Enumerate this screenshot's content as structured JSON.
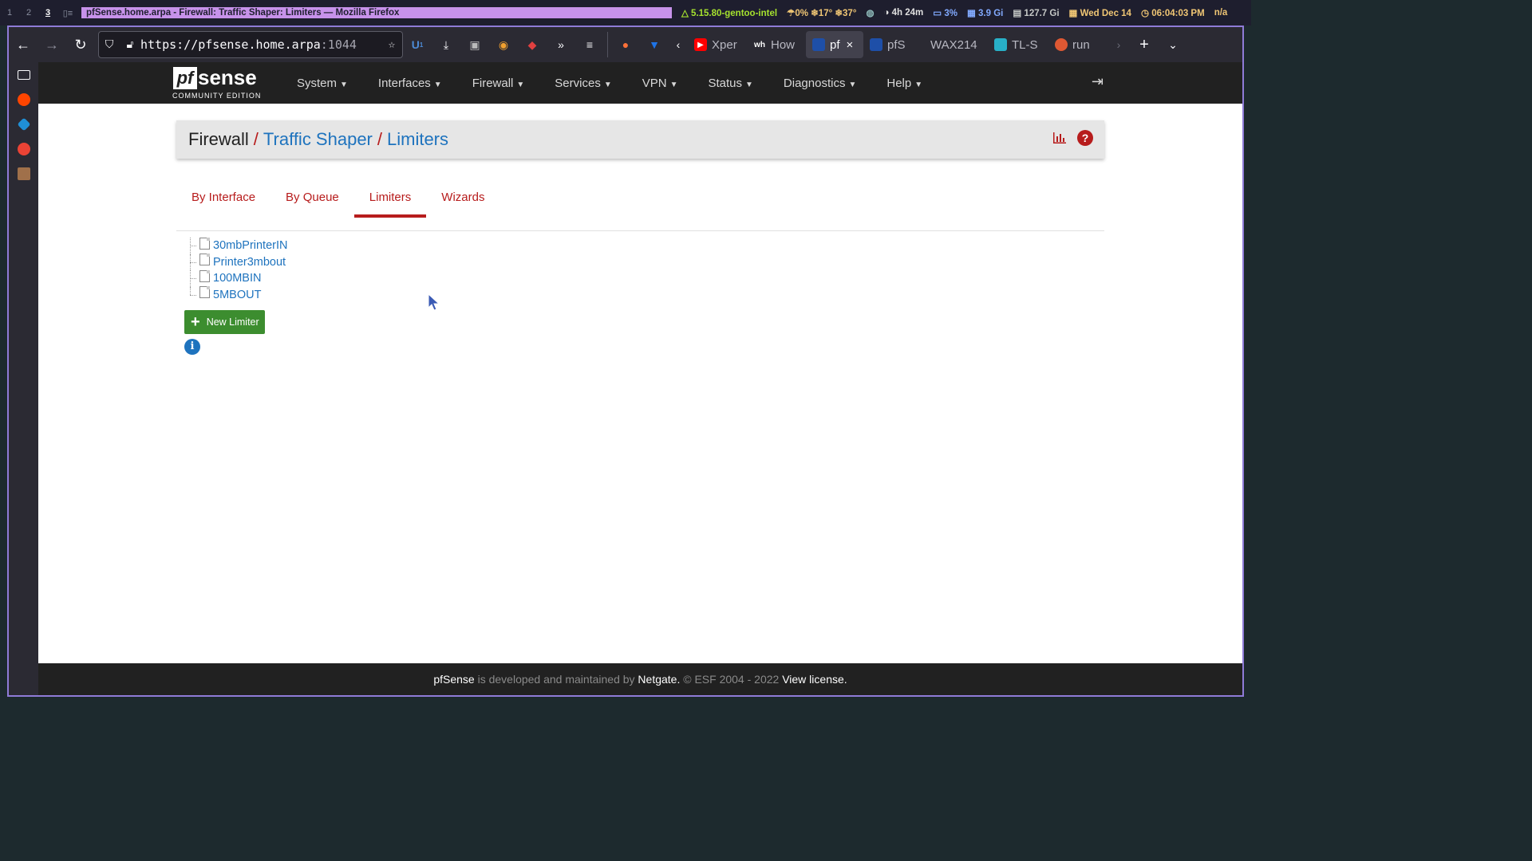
{
  "statusbar": {
    "workspaces": [
      "1",
      "2",
      "3"
    ],
    "layout_icon": "layout-icon",
    "window_title": "pfSense.home.arpa - Firewall: Traffic Shaper: Limiters — Mozilla Firefox",
    "kernel": "5.15.80-gentoo-intel",
    "weather": "0% ❄17° ❄37°",
    "uptime": "4h 24m",
    "cpu": "3%",
    "mem": "3.9 Gi",
    "disk": "127.7 Gi",
    "date": "Wed Dec 14",
    "time": "06:04:03 PM",
    "na": "n/a"
  },
  "browser": {
    "url_host": "https://pfsense.home.arpa",
    "url_port": ":1044",
    "ublock_badge": "1",
    "tabs": [
      {
        "label": "Xper",
        "fav_color": "#ff0000"
      },
      {
        "label": "How",
        "fav_color": "#2b2a33"
      },
      {
        "label": "pf",
        "fav_color": "#1e4fa8",
        "active": true
      },
      {
        "label": "pfS",
        "fav_color": "#1e4fa8"
      },
      {
        "label": "WAX214",
        "fav_color": ""
      },
      {
        "label": "TL-S",
        "fav_color": "#28b0c8"
      },
      {
        "label": "run",
        "fav_color": "#de5833"
      }
    ]
  },
  "pfsense": {
    "logo_pf": "pf",
    "logo_sense": "sense",
    "logo_edition": "COMMUNITY EDITION",
    "nav": [
      "System",
      "Interfaces",
      "Firewall",
      "Services",
      "VPN",
      "Status",
      "Diagnostics",
      "Help"
    ],
    "breadcrumb": [
      "Firewall",
      "Traffic Shaper",
      "Limiters"
    ],
    "tabs": [
      {
        "label": "By Interface",
        "active": false
      },
      {
        "label": "By Queue",
        "active": false
      },
      {
        "label": "Limiters",
        "active": true
      },
      {
        "label": "Wizards",
        "active": false
      }
    ],
    "limiters": [
      "30mbPrinterIN",
      "Printer3mbout",
      "100MBIN",
      "5MBOUT"
    ],
    "new_button": "New Limiter",
    "footer": {
      "brand": "pfSense",
      "text1": " is developed and maintained by ",
      "company": "Netgate.",
      "text2": " © ESF 2004 - 2022 ",
      "license": "View license."
    }
  }
}
